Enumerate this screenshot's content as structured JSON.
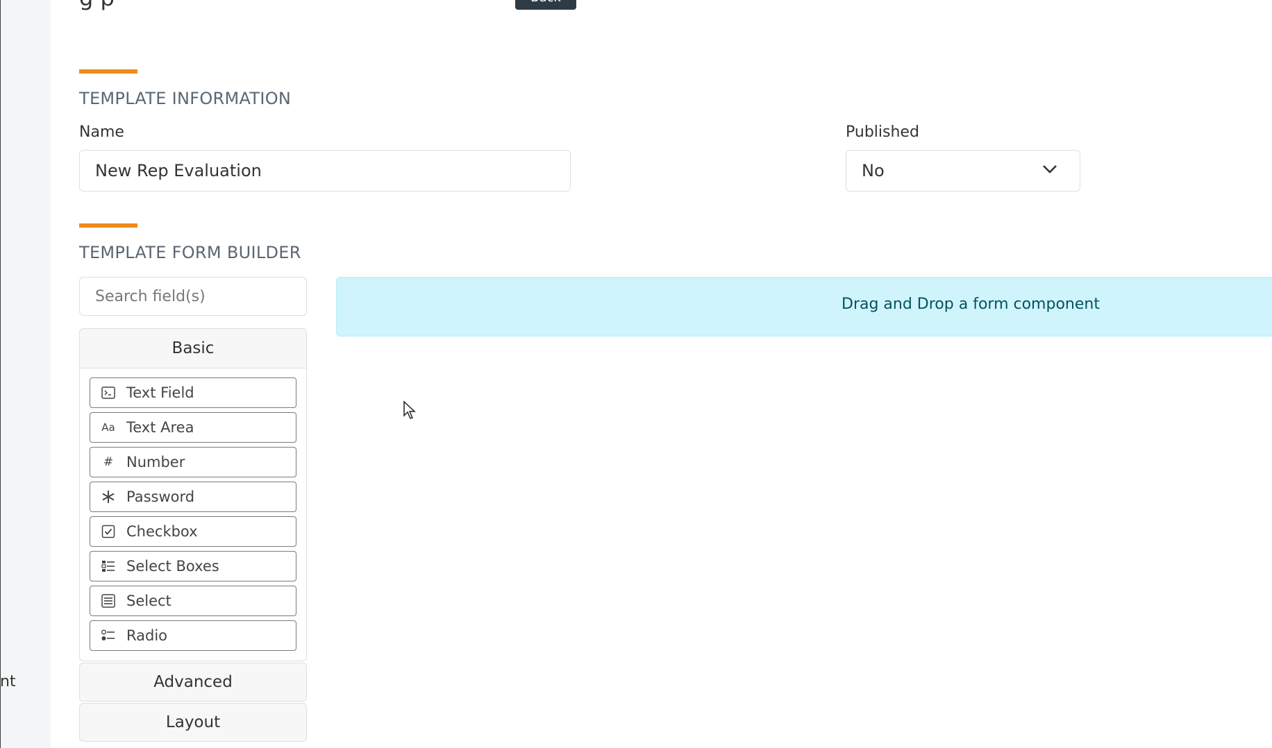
{
  "header": {
    "title_cut": "g p",
    "back_label": "Back"
  },
  "sidebar": {
    "partial_text": "nt"
  },
  "template_info": {
    "title": "TEMPLATE INFORMATION",
    "name_label": "Name",
    "name_value": "New Rep Evaluation",
    "published_label": "Published",
    "published_value": "No"
  },
  "form_builder": {
    "title": "TEMPLATE FORM BUILDER",
    "search_placeholder": "Search field(s)",
    "drop_text": "Drag and Drop a form component",
    "groups": {
      "basic": "Basic",
      "advanced": "Advanced",
      "layout": "Layout"
    },
    "components": [
      {
        "label": "Text Field",
        "icon": "terminal-icon"
      },
      {
        "label": "Text Area",
        "icon": "font-icon"
      },
      {
        "label": "Number",
        "icon": "hash-icon"
      },
      {
        "label": "Password",
        "icon": "asterisk-icon"
      },
      {
        "label": "Checkbox",
        "icon": "check-square-icon"
      },
      {
        "label": "Select Boxes",
        "icon": "checklist-icon"
      },
      {
        "label": "Select",
        "icon": "list-box-icon"
      },
      {
        "label": "Radio",
        "icon": "radio-list-icon"
      }
    ]
  },
  "colors": {
    "accent": "#f08a1c",
    "drop_zone_bg": "#cff4fc",
    "drop_zone_text": "#055160",
    "back_button_bg": "#2f3b44"
  }
}
